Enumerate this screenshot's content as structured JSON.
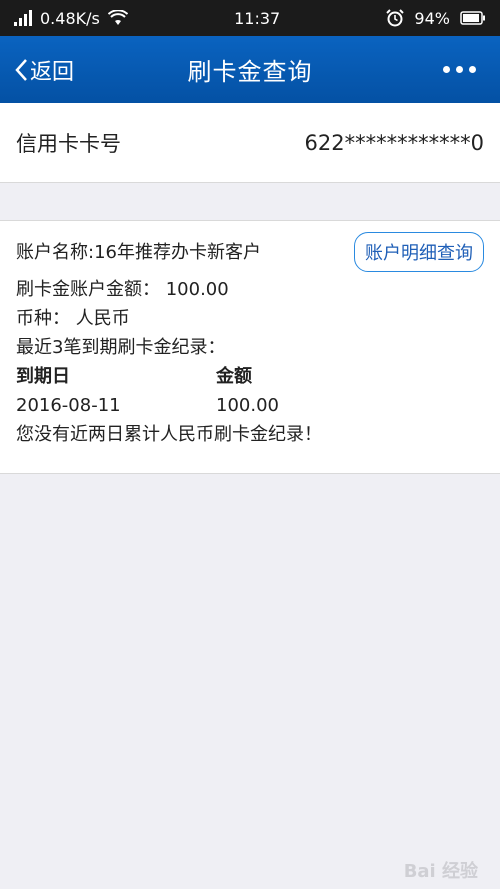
{
  "status_bar": {
    "network_speed": "0.48K/s",
    "time": "11:37",
    "battery": "94%"
  },
  "nav": {
    "back_label": "返回",
    "title": "刷卡金查询"
  },
  "card": {
    "label": "信用卡卡号",
    "number": "622************0"
  },
  "info": {
    "account_name": "账户名称:16年推荐办卡新客户",
    "detail_button": "账户明细查询",
    "balance": "刷卡金账户金额：  100.00",
    "currency": "币种：  人民币",
    "recent_title": "最近3笔到期刷卡金纪录：",
    "table_headers": [
      "到期日",
      "金额"
    ],
    "rows": [
      {
        "date": "2016-08-11",
        "amount": "100.00"
      }
    ],
    "notice": "您没有近两日累计人民币刷卡金纪录！"
  },
  "watermark": "Bai 经验"
}
